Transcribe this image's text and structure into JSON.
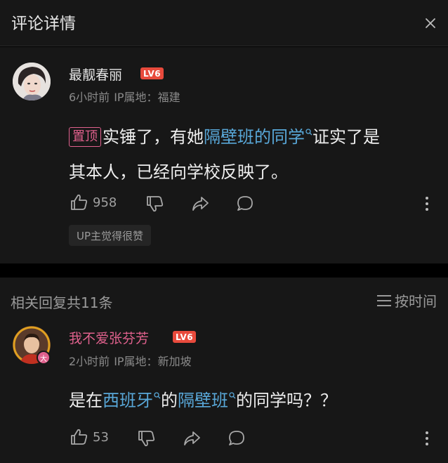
{
  "header": {
    "title": "评论详情"
  },
  "main_comment": {
    "username": "最靓春丽",
    "level": "LV6",
    "time": "6小时前",
    "ip_label": "IP属地：",
    "ip_location": "福建",
    "pin_tag": "置顶",
    "content_part1": "实锤了，有她",
    "link_text": "隔壁班的同学",
    "content_part2": "证实了是",
    "content_line2": "其本人，已经向学校反映了。",
    "like_count": "958",
    "up_tag": "UP主觉得很赞"
  },
  "replies": {
    "count_label": "相关回复共11条",
    "sort_label": "按时间",
    "items": [
      {
        "username": "我不爱张芬芳",
        "level": "LV6",
        "avatar_badge": "大",
        "time": "2小时前",
        "ip_label": "IP属地：",
        "ip_location": "新加坡",
        "content_part1": "是在",
        "link1": "西班牙",
        "content_part2": "的",
        "link2": "隔壁班",
        "content_part3": "的同学吗？？",
        "like_count": "53"
      }
    ]
  },
  "colors": {
    "background": "#171717",
    "link": "#59a8d9",
    "pink_username": "#e0618d",
    "level_badge": "#e84a3c",
    "muted": "#8a8a8a"
  },
  "icons": [
    "close-icon",
    "like-icon",
    "dislike-icon",
    "share-icon",
    "comment-icon",
    "more-icon",
    "sort-icon",
    "search-icon"
  ]
}
